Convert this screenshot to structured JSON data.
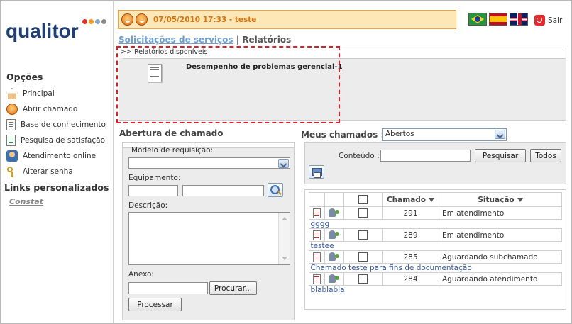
{
  "header": {
    "datetime_user": "07/05/2010 17:33 - teste",
    "exit_label": "Sair"
  },
  "logo": {
    "text": "qualitor",
    "dot_colors": [
      "#e0322b",
      "#f39b21",
      "#8aa7c4",
      "#8a8a8a"
    ]
  },
  "sidebar": {
    "options_title": "Opções",
    "items": [
      {
        "label": "Principal",
        "icon": "home-icon"
      },
      {
        "label": "Abrir chamado",
        "icon": "open-ticket-icon"
      },
      {
        "label": "Base de conhecimento",
        "icon": "knowledge-base-icon"
      },
      {
        "label": "Pesquisa de satisfação",
        "icon": "survey-icon"
      },
      {
        "label": "Atendimento online",
        "icon": "online-support-icon"
      },
      {
        "label": "Alterar senha",
        "icon": "keys-icon"
      }
    ],
    "links_title": "Links personalizados",
    "custom_link": "Constat"
  },
  "breadcrumb": {
    "link": "Solicitações de serviços",
    "separator": " | ",
    "current": "Relatórios"
  },
  "reports": {
    "header": ">> Relatórios disponíveis",
    "items": [
      {
        "name": "Desempenho de problemas gerencial-1",
        "icon": "report-document-icon"
      }
    ]
  },
  "abertura": {
    "title": "Abertura de chamado",
    "modelo_label": "Modelo de requisição:",
    "modelo_value": "",
    "equipamento_label": "Equipamento:",
    "descricao_label": "Descrição:",
    "anexo_label": "Anexo:",
    "procurar_label": "Procurar...",
    "processar_label": "Processar"
  },
  "meus": {
    "title": "Meus chamados :",
    "status_value": "Abertos",
    "conteudo_label": "Conteúdo :",
    "pesquisar_label": "Pesquisar",
    "todos_label": "Todos",
    "columns": {
      "chamado": "Chamado",
      "situacao": "Situação"
    },
    "rows": [
      {
        "chamado": "291",
        "situacao": "Em atendimento",
        "descricao": "gggg"
      },
      {
        "chamado": "289",
        "situacao": "Em atendimento",
        "descricao": "testee"
      },
      {
        "chamado": "285",
        "situacao": "Aguardando subchamado",
        "descricao": "Chamado teste para fins de documentação"
      },
      {
        "chamado": "284",
        "situacao": "Aguardando atendimento",
        "descricao": "blablabla"
      }
    ]
  },
  "colors": {
    "accent_orange": "#d8740f",
    "header_bg": "#fde7b6",
    "panel_bg": "#ececec",
    "link_blue": "#6d9fd0",
    "highlight_dash": "#d9202b"
  }
}
